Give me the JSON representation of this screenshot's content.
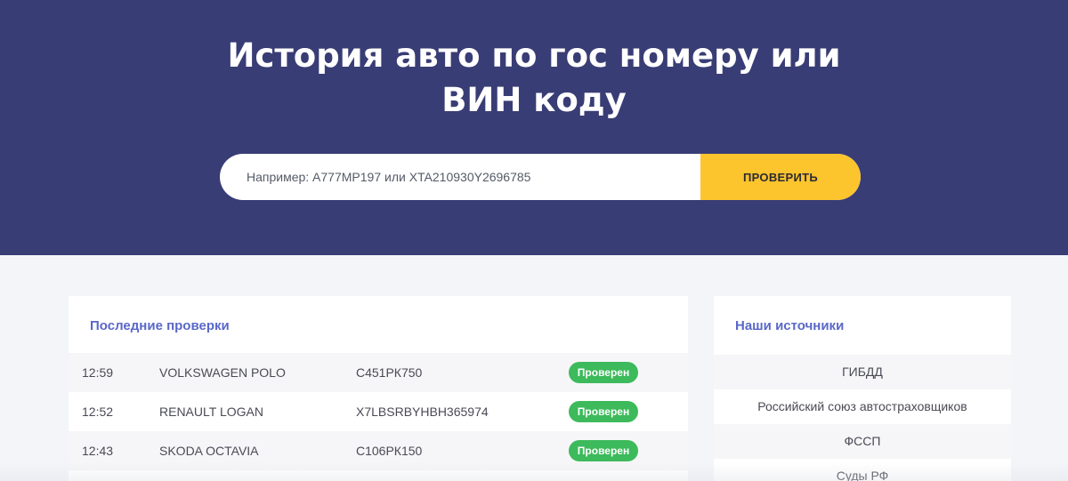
{
  "hero": {
    "title_line1": "История авто по гос номеру или",
    "title_line2": "ВИН коду"
  },
  "search": {
    "placeholder": "Например: А777МР197 или XTA210930Y2696785",
    "value": "",
    "button_label": "ПРОВЕРИТЬ"
  },
  "recent": {
    "title": "Последние проверки",
    "rows": [
      {
        "time": "12:59",
        "model": "VOLKSWAGEN POLO",
        "plate": "С451РК750",
        "status": "Проверен"
      },
      {
        "time": "12:52",
        "model": "RENAULT LOGAN",
        "plate": "X7LBSRBYHBH365974",
        "status": "Проверен"
      },
      {
        "time": "12:43",
        "model": "SKODA OCTAVIA",
        "plate": "С106РК150",
        "status": "Проверен"
      }
    ]
  },
  "sources": {
    "title": "Наши источники",
    "items": [
      "ГИБДД",
      "Российский союз автостраховщиков",
      "ФССП",
      "Суды РФ"
    ]
  },
  "colors": {
    "hero_bg": "#393d75",
    "accent_yellow": "#fcc42d",
    "title_blue": "#5a68c8",
    "badge_green": "#3dba5b"
  }
}
